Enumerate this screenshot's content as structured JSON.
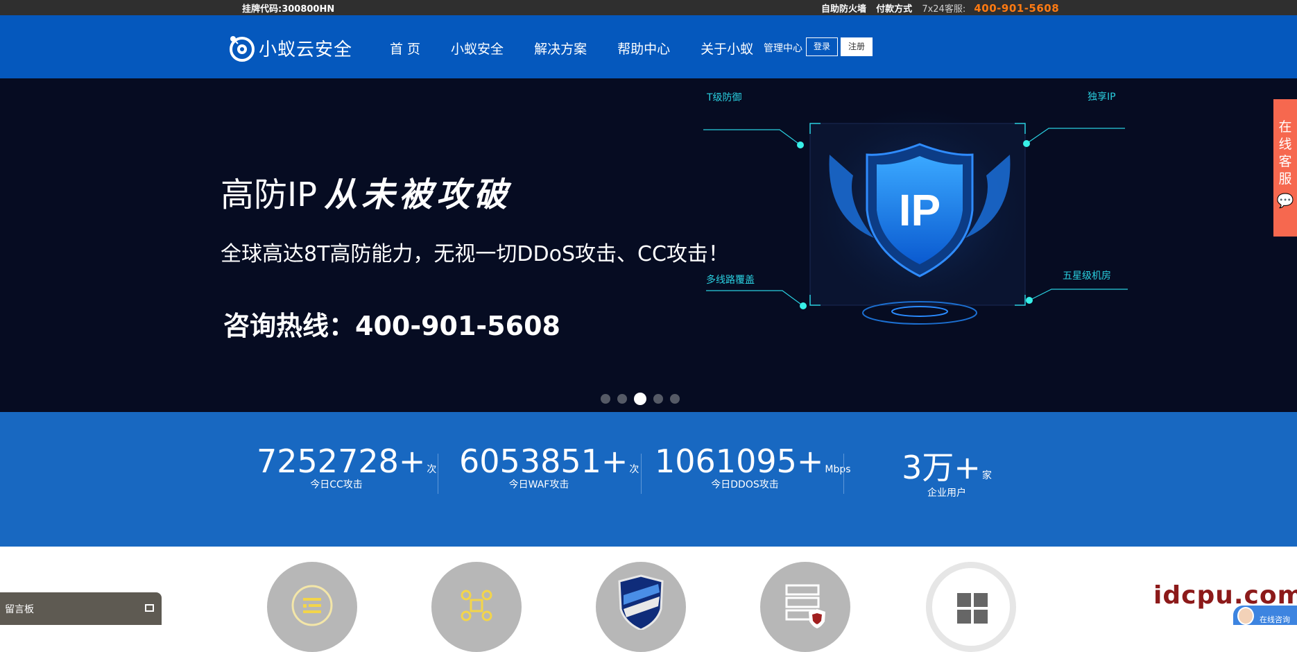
{
  "topbar": {
    "stock_code": "挂牌代码:300800HN",
    "links": [
      "自助防火墙",
      "付款方式"
    ],
    "service_label": "7x24客服:",
    "phone": "400-901-5608"
  },
  "nav": {
    "logo_text": "小蚁云安全",
    "menu": [
      "首 页",
      "小蚁安全",
      "解决方案",
      "帮助中心",
      "关于小蚁"
    ],
    "manage": "管理中心",
    "login": "登录",
    "register": "注册"
  },
  "banner": {
    "title_main": "高防IP",
    "title_script": "从未被攻破",
    "subtitle": "全球高达8T高防能力，无视一切DDoS攻击、CC攻击！",
    "hotline": "咨询热线：400-901-5608",
    "shield_text": "IP",
    "labels": [
      "T级防御",
      "独享IP",
      "多线路覆盖",
      "五星级机房"
    ],
    "slides": 5,
    "active_slide": 3
  },
  "stats": [
    {
      "value": "7252728+",
      "unit": "次",
      "label": "今日CC攻击"
    },
    {
      "value": "6053851+",
      "unit": "次",
      "label": "今日WAF攻击"
    },
    {
      "value": "1061095+",
      "unit": "Mbps",
      "label": "今日DDOS攻击"
    },
    {
      "value": "3万+",
      "unit": "家",
      "label": "企业用户"
    }
  ],
  "side_service": {
    "label": "在线客服",
    "chars": [
      "在",
      "线",
      "客",
      "服"
    ]
  },
  "message_board": {
    "label": "留言板"
  },
  "watermark": "idcpu.com",
  "consult": {
    "label": "在线咨询"
  },
  "colors": {
    "topbar": "#2f2f2f",
    "nav": "#0558bd",
    "banner": "#060c22",
    "stats": "#1868c1",
    "accent_orange": "#ff7a12",
    "side_tab": "#f6684f"
  }
}
